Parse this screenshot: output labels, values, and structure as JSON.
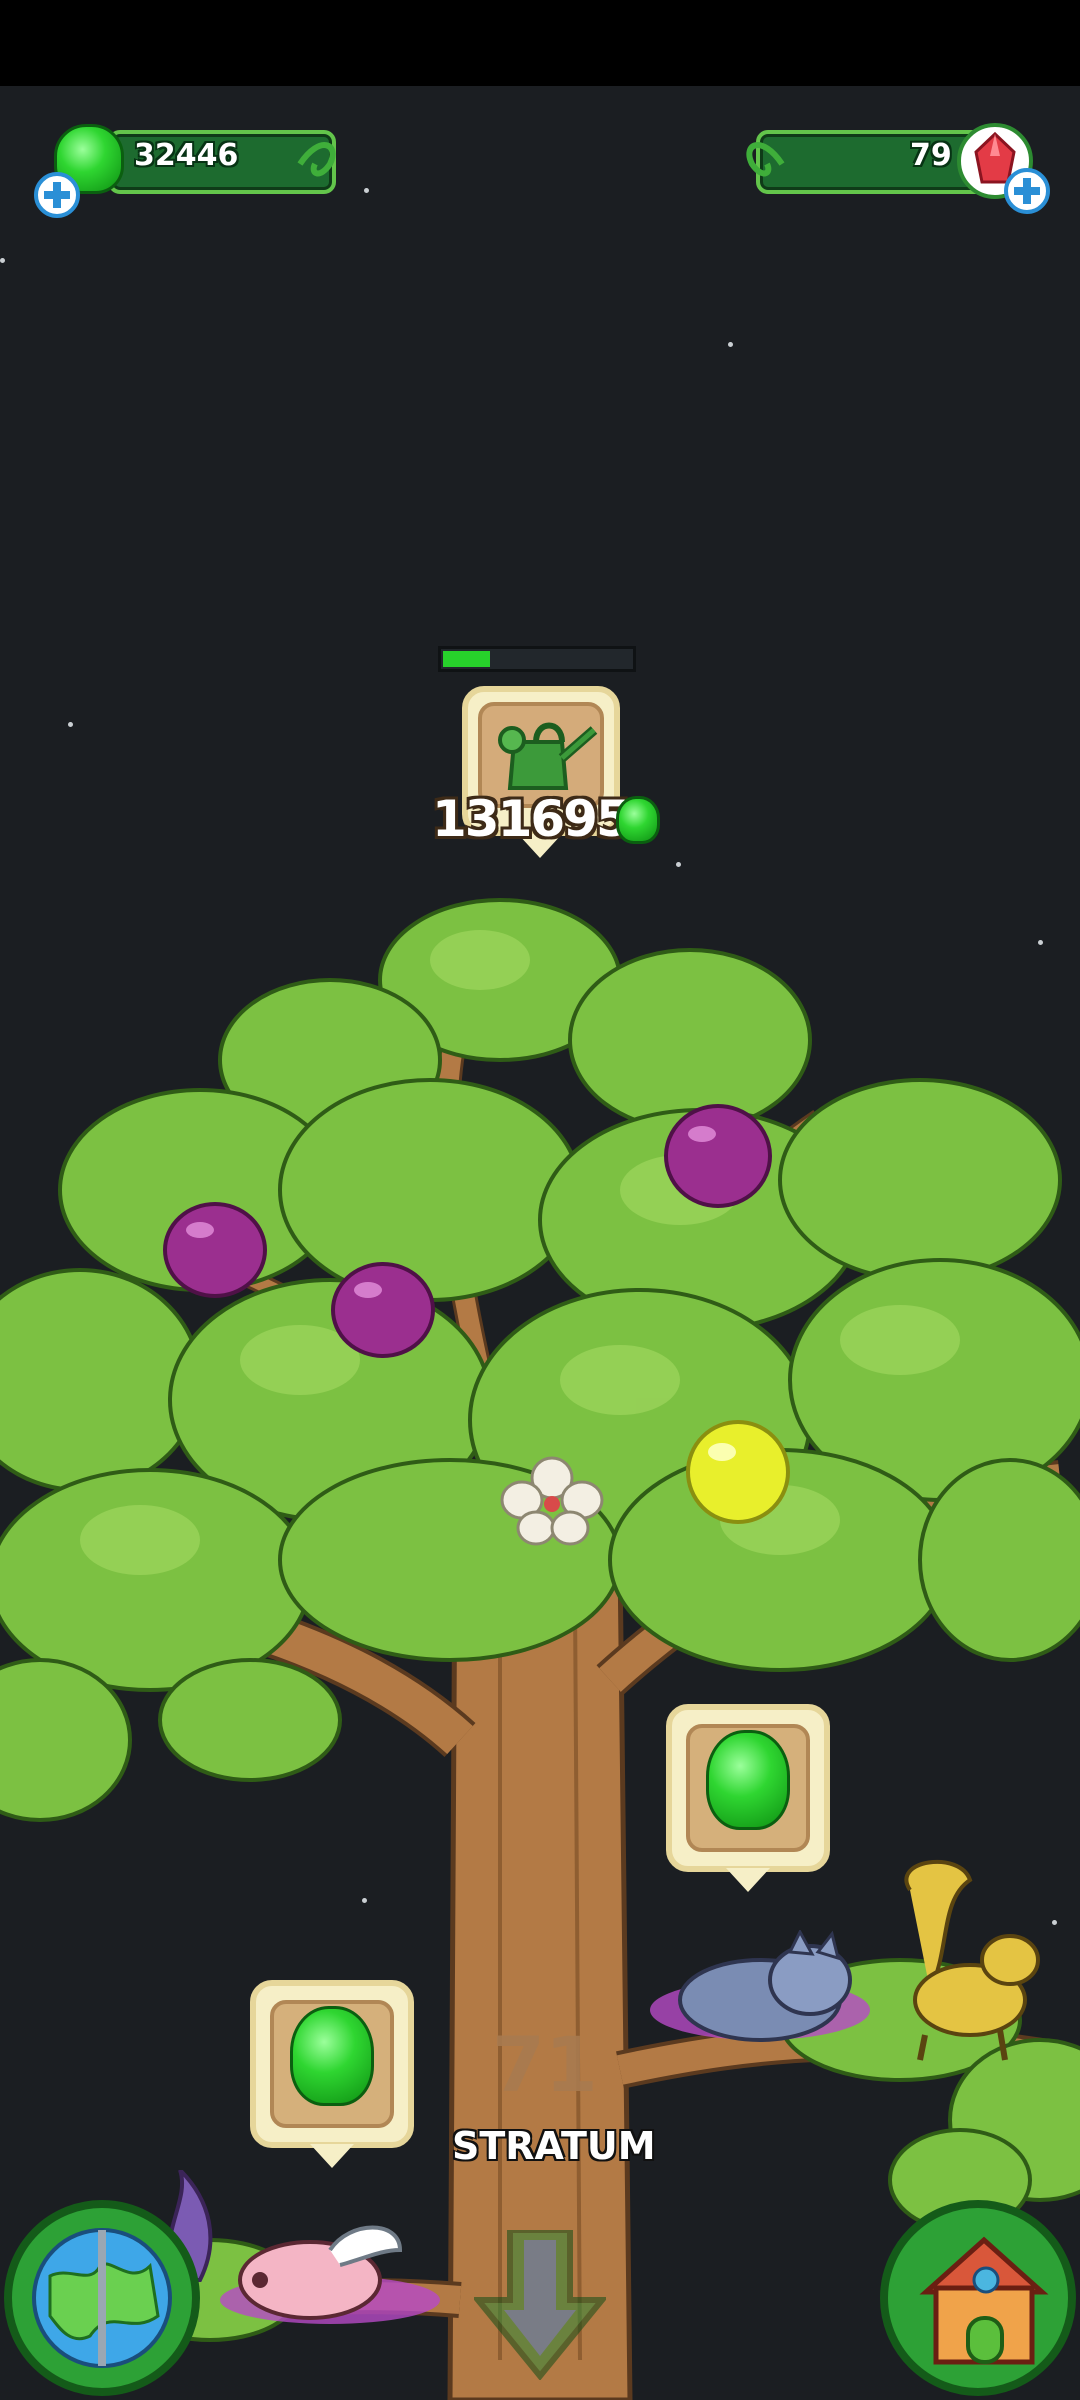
{
  "resources": {
    "jelly_count": "32446",
    "gem_count": "79"
  },
  "tree": {
    "watering_cost": "131695",
    "water_progress": 0.25,
    "stratum_number": "71",
    "stratum_label": "STRATUM"
  },
  "icons": {
    "jelly": "green-jelly-icon",
    "gem": "red-gem-icon",
    "watering": "watering-can-icon",
    "globe": "globe-icon",
    "house": "house-icon",
    "arrow": "down-arrow-icon"
  },
  "colors": {
    "background": "#1b1e22",
    "jelly_green": "#2fd631",
    "leaf_green": "#7cc142",
    "trunk_brown": "#b37a45",
    "gem_red": "#e33b46"
  }
}
